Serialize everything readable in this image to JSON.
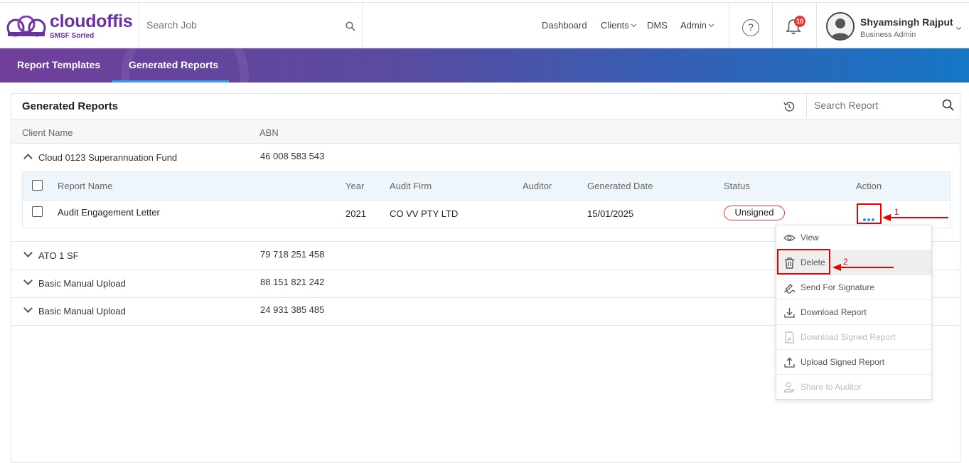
{
  "header": {
    "logo_text": "cloudoffis",
    "logo_tagline": "SMSF Sorted",
    "search_placeholder": "Search Job",
    "nav": {
      "dashboard": "Dashboard",
      "clients": "Clients",
      "dms": "DMS",
      "admin": "Admin"
    },
    "help_glyph": "?",
    "notification_count": "10",
    "user_name": "Shyamsingh Rajput",
    "user_role": "Business Admin"
  },
  "tabs": {
    "report_templates": "Report Templates",
    "generated_reports": "Generated Reports",
    "active": "Generated Reports"
  },
  "panel": {
    "title": "Generated Reports",
    "search_placeholder": "Search Report",
    "columns": {
      "client_name": "Client Name",
      "abn": "ABN"
    },
    "clients": [
      {
        "name": "Cloud 0123 Superannuation Fund",
        "abn": "46 008 583 543",
        "expanded": true
      },
      {
        "name": "ATO 1 SF",
        "abn": "79 718 251 458",
        "expanded": false
      },
      {
        "name": "Basic Manual Upload",
        "abn": "88 151 821 242",
        "expanded": false
      },
      {
        "name": "Basic Manual Upload",
        "abn": "24 931 385 485",
        "expanded": false
      }
    ],
    "report_columns": {
      "report_name": "Report Name",
      "year": "Year",
      "audit_firm": "Audit Firm",
      "auditor": "Auditor",
      "generated_date": "Generated Date",
      "status": "Status",
      "action": "Action"
    },
    "reports": [
      {
        "report_name": "Audit Engagement Letter",
        "year": "2021",
        "audit_firm": "CO VV PTY LTD",
        "auditor": "",
        "generated_date": "15/01/2025",
        "status": "Unsigned"
      }
    ]
  },
  "action_menu": {
    "items": [
      {
        "label": "View",
        "icon": "eye-icon",
        "enabled": true
      },
      {
        "label": "Delete",
        "icon": "trash-icon",
        "enabled": true
      },
      {
        "label": "Send For Signature",
        "icon": "signature-icon",
        "enabled": true
      },
      {
        "label": "Download Report",
        "icon": "download-icon",
        "enabled": true
      },
      {
        "label": "Download Signed Report",
        "icon": "signed-document-icon",
        "enabled": false
      },
      {
        "label": "Upload Signed Report",
        "icon": "upload-icon",
        "enabled": true
      },
      {
        "label": "Share to Auditor",
        "icon": "share-user-icon",
        "enabled": false
      }
    ]
  },
  "annotations": {
    "step1": "1",
    "step2": "2"
  },
  "colors": {
    "brand_purple": "#6b2fa6",
    "accent_blue": "#2196f3",
    "status_red": "#e53935",
    "annotation_red": "#e00000"
  }
}
